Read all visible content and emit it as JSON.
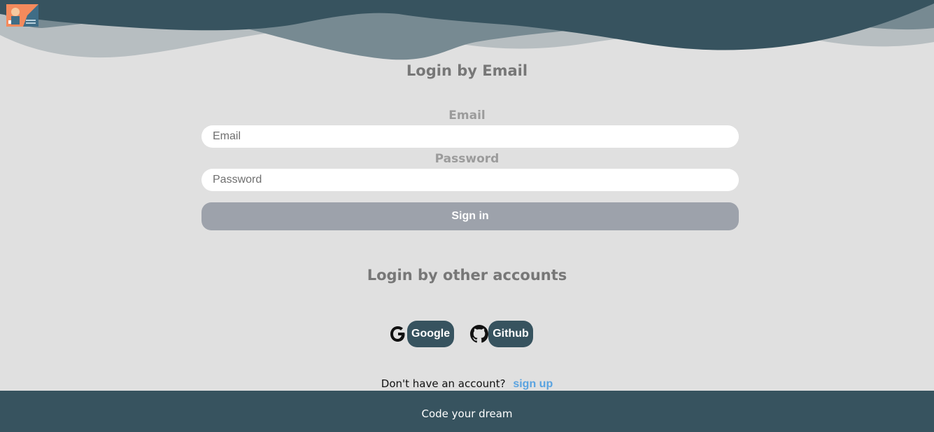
{
  "colors": {
    "background": "#e0e0e0",
    "wave_dark": "#37535f",
    "wave_mid": "#778a92",
    "wave_light": "#b7bec1",
    "sign_in_button": "#9da2ab",
    "provider_button": "#37535f",
    "link": "#5aa3e0",
    "footer": "#37535f"
  },
  "header": {
    "logo_icon": "app-logo-icon"
  },
  "email_login": {
    "title": "Login by Email",
    "email_label": "Email",
    "email_placeholder": "Email",
    "email_value": "",
    "password_label": "Password",
    "password_placeholder": "Password",
    "password_value": "",
    "sign_in_label": "Sign in"
  },
  "other_login": {
    "title": "Login by other accounts",
    "providers": [
      {
        "icon": "google-icon",
        "label": "Google"
      },
      {
        "icon": "github-icon",
        "label": "Github"
      }
    ]
  },
  "signup": {
    "prompt": "Don't have an account?",
    "link_label": "sign up"
  },
  "footer": {
    "text": "Code your dream"
  }
}
